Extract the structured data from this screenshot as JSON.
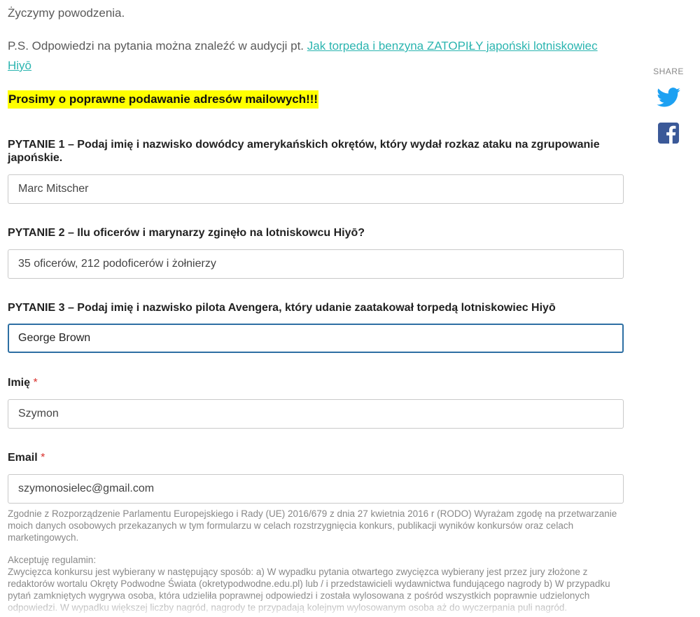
{
  "content": {
    "wish": "Życzymy powodzenia.",
    "ps_text": "P.S. Odpowiedzi na pytania można znaleźć w audycji pt. ",
    "ps_link": "Jak torpeda i benzyna ZATOPIŁY japoński lotniskowiec Hiyō",
    "highlight": "Prosimy o poprawne podawanie adresów mailowych!!!"
  },
  "form": {
    "q1": {
      "label": "PYTANIE 1 – Podaj imię i nazwisko dowódcy amerykańskich okrętów, który wydał rozkaz ataku na zgrupowanie japońskie.",
      "value": "Marc Mitscher"
    },
    "q2": {
      "label": "PYTANIE 2 – Ilu oficerów i marynarzy zginęło na lotniskowcu Hiyō?",
      "value": "35 oficerów, 212 podoficerów i żołnierzy"
    },
    "q3": {
      "label": "PYTANIE 3 – Podaj imię i nazwisko pilota Avengera, który udanie zaatakował torpedą lotniskowiec Hiyō",
      "value": "George Brown"
    },
    "name": {
      "label": "Imię",
      "required_mark": "*",
      "value": "Szymon"
    },
    "email": {
      "label": "Email",
      "required_mark": "*",
      "value": "szymonosielec@gmail.com"
    },
    "consent_text": "Zgodnie z Rozporządzenie Parlamentu Europejskiego i Rady (UE) 2016/679 z dnia 27 kwietnia 2016 r (RODO) Wyrażam zgodę na przetwarzanie moich danych osobowych przekazanych w tym formularzu w celach rozstrzygnięcia konkurs, publikacji wyników konkursów oraz celach marketingowych.",
    "rules_title": "Akceptuję regulamin:",
    "rules_text": "Zwycięzca konkursu jest wybierany w następujący sposób: a) W wypadku pytania otwartego zwycięzca wybierany jest przez jury złożone z redaktorów wortalu Okręty Podwodne Świata (okretypodwodne.edu.pl)  lub / i przedstawicieli wydawnictwa fundującego nagrody b) W przypadku pytań zamkniętych wygrywa osoba, która udzieliła poprawnej odpowiedzi i została wylosowana z pośród wszystkich poprawnie udzielonych odpowiedzi. W wypadku większej liczby nagród, nagrody te przypadają kolejnym wylosowanym osoba aż do wyczerpania puli nagród."
  },
  "share": {
    "label": "SHARE",
    "icons": [
      "twitter-icon",
      "facebook-icon"
    ],
    "colors": {
      "twitter": "#1da1f2",
      "facebook": "#3b5998"
    }
  },
  "colors": {
    "link": "#2bb5b0",
    "highlight": "#ffff00",
    "focus": "#2d6fa3",
    "required": "#d9302c"
  }
}
